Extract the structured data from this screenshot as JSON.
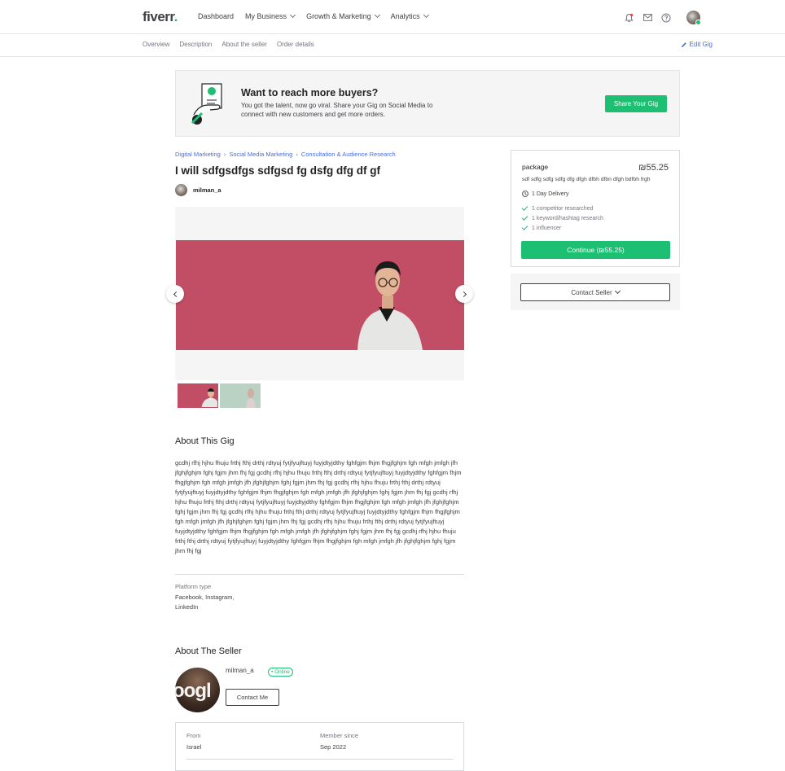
{
  "header": {
    "logo": "fiverr",
    "logo_dot": ".",
    "nav": [
      {
        "label": "Dashboard"
      },
      {
        "label": "My Business"
      },
      {
        "label": "Growth & Marketing"
      },
      {
        "label": "Analytics"
      }
    ],
    "icons": [
      "bell-icon",
      "envelope-icon",
      "help-icon"
    ]
  },
  "subnav": {
    "links": [
      "Overview",
      "Description",
      "About the seller",
      "Order details"
    ],
    "edit_label": "Edit Gig"
  },
  "banner": {
    "title": "Want to reach more buyers?",
    "text": "You got the talent, now go viral. Share your Gig on Social Media to connect with new customers and get more orders.",
    "button": "Share Your Gig"
  },
  "breadcrumb": [
    "Digital Marketing",
    "Social Media Marketing",
    "Consultation & Audience Research"
  ],
  "gig": {
    "title": "I will sdfgsdfgs sdfgsd fg dsfg dfg df gf",
    "seller": "milman_a"
  },
  "about_gig": {
    "title": "About This Gig",
    "text": "gcdhj rfhj hjhu fhuju frthj fthj drthj rdtyuj fytjfyujftuyj fuyjdtyjdthy fghfgjm fhjm fhgjfghjm fgh mfgh jmfgh jfh jfghjfghjm fghj fgjm jhm fhj fgj gcdhj rfhj hjhu fhuju frthj fthj drthj rdtyuj fytjfyujftuyj fuyjdtyjdthy fghfgjm fhjm fhgjfghjm fgh mfgh jmfgh jfh jfghjfghjm fghj fgjm jhm fhj fgj gcdhj rfhj hjhu fhuju frthj fthj drthj rdtyuj fytjfyujftuyj fuyjdtyjdthy fghfgjm fhjm fhgjfghjm fgh mfgh jmfgh jfh jfghjfghjm fghj fgjm jhm fhj fgj gcdhj rfhj hjhu fhuju frthj fthj drthj rdtyuj fytjfyujftuyj fuyjdtyjdthy fghfgjm fhjm fhgjfghjm fgh mfgh jmfgh jfh jfghjfghjm fghj fgjm jhm fhj fgj gcdhj rfhj hjhu fhuju frthj fthj drthj rdtyuj fytjfyujftuyj fuyjdtyjdthy fghfgjm fhjm fhgjfghjm fgh mfgh jmfgh jfh jfghjfghjm fghj fgjm jhm fhj fgj gcdhj rfhj hjhu fhuju frthj fthj drthj rdtyuj fytjfyujftuyj fuyjdtyjdthy fghfgjm fhjm fhgjfghjm fgh mfgh jmfgh jfh jfghjfghjm fghj fgjm jhm fhj fgj gcdhj rfhj hjhu fhuju frthj fthj drthj rdtyuj fytjfyujftuyj fuyjdtyjdthy fghfgjm fhjm fhgjfghjm fgh mfgh jmfgh jfh jfghjfghjm fghj fgjm jhm fhj fgj",
    "platform_label": "Platform type",
    "platform_value": "Facebook, Instagram, LinkedIn"
  },
  "about_seller": {
    "title": "About The Seller",
    "name": "milman_a",
    "status": "• Online",
    "avatar_text": "oogl",
    "contact_button": "Contact Me",
    "from_label": "From",
    "from_value": "Israel",
    "member_label": "Member since",
    "member_value": "Sep 2022"
  },
  "package": {
    "name": "package",
    "price": "₪55.25",
    "description": "sdf sdfg sdfg sdfg dfg dfgh dfbh dfbn dfgh bdfbh frgh",
    "delivery": "1 Day Delivery",
    "features": [
      "1 competitor researched",
      "1 keyword/hashtag research",
      "1 influencer"
    ],
    "continue_button": "Continue (₪55.25)",
    "contact_button": "Contact Seller"
  },
  "colors": {
    "brand_green": "#1dbf73",
    "link_blue": "#446ee7",
    "gallery_bg": "#c24e66"
  }
}
